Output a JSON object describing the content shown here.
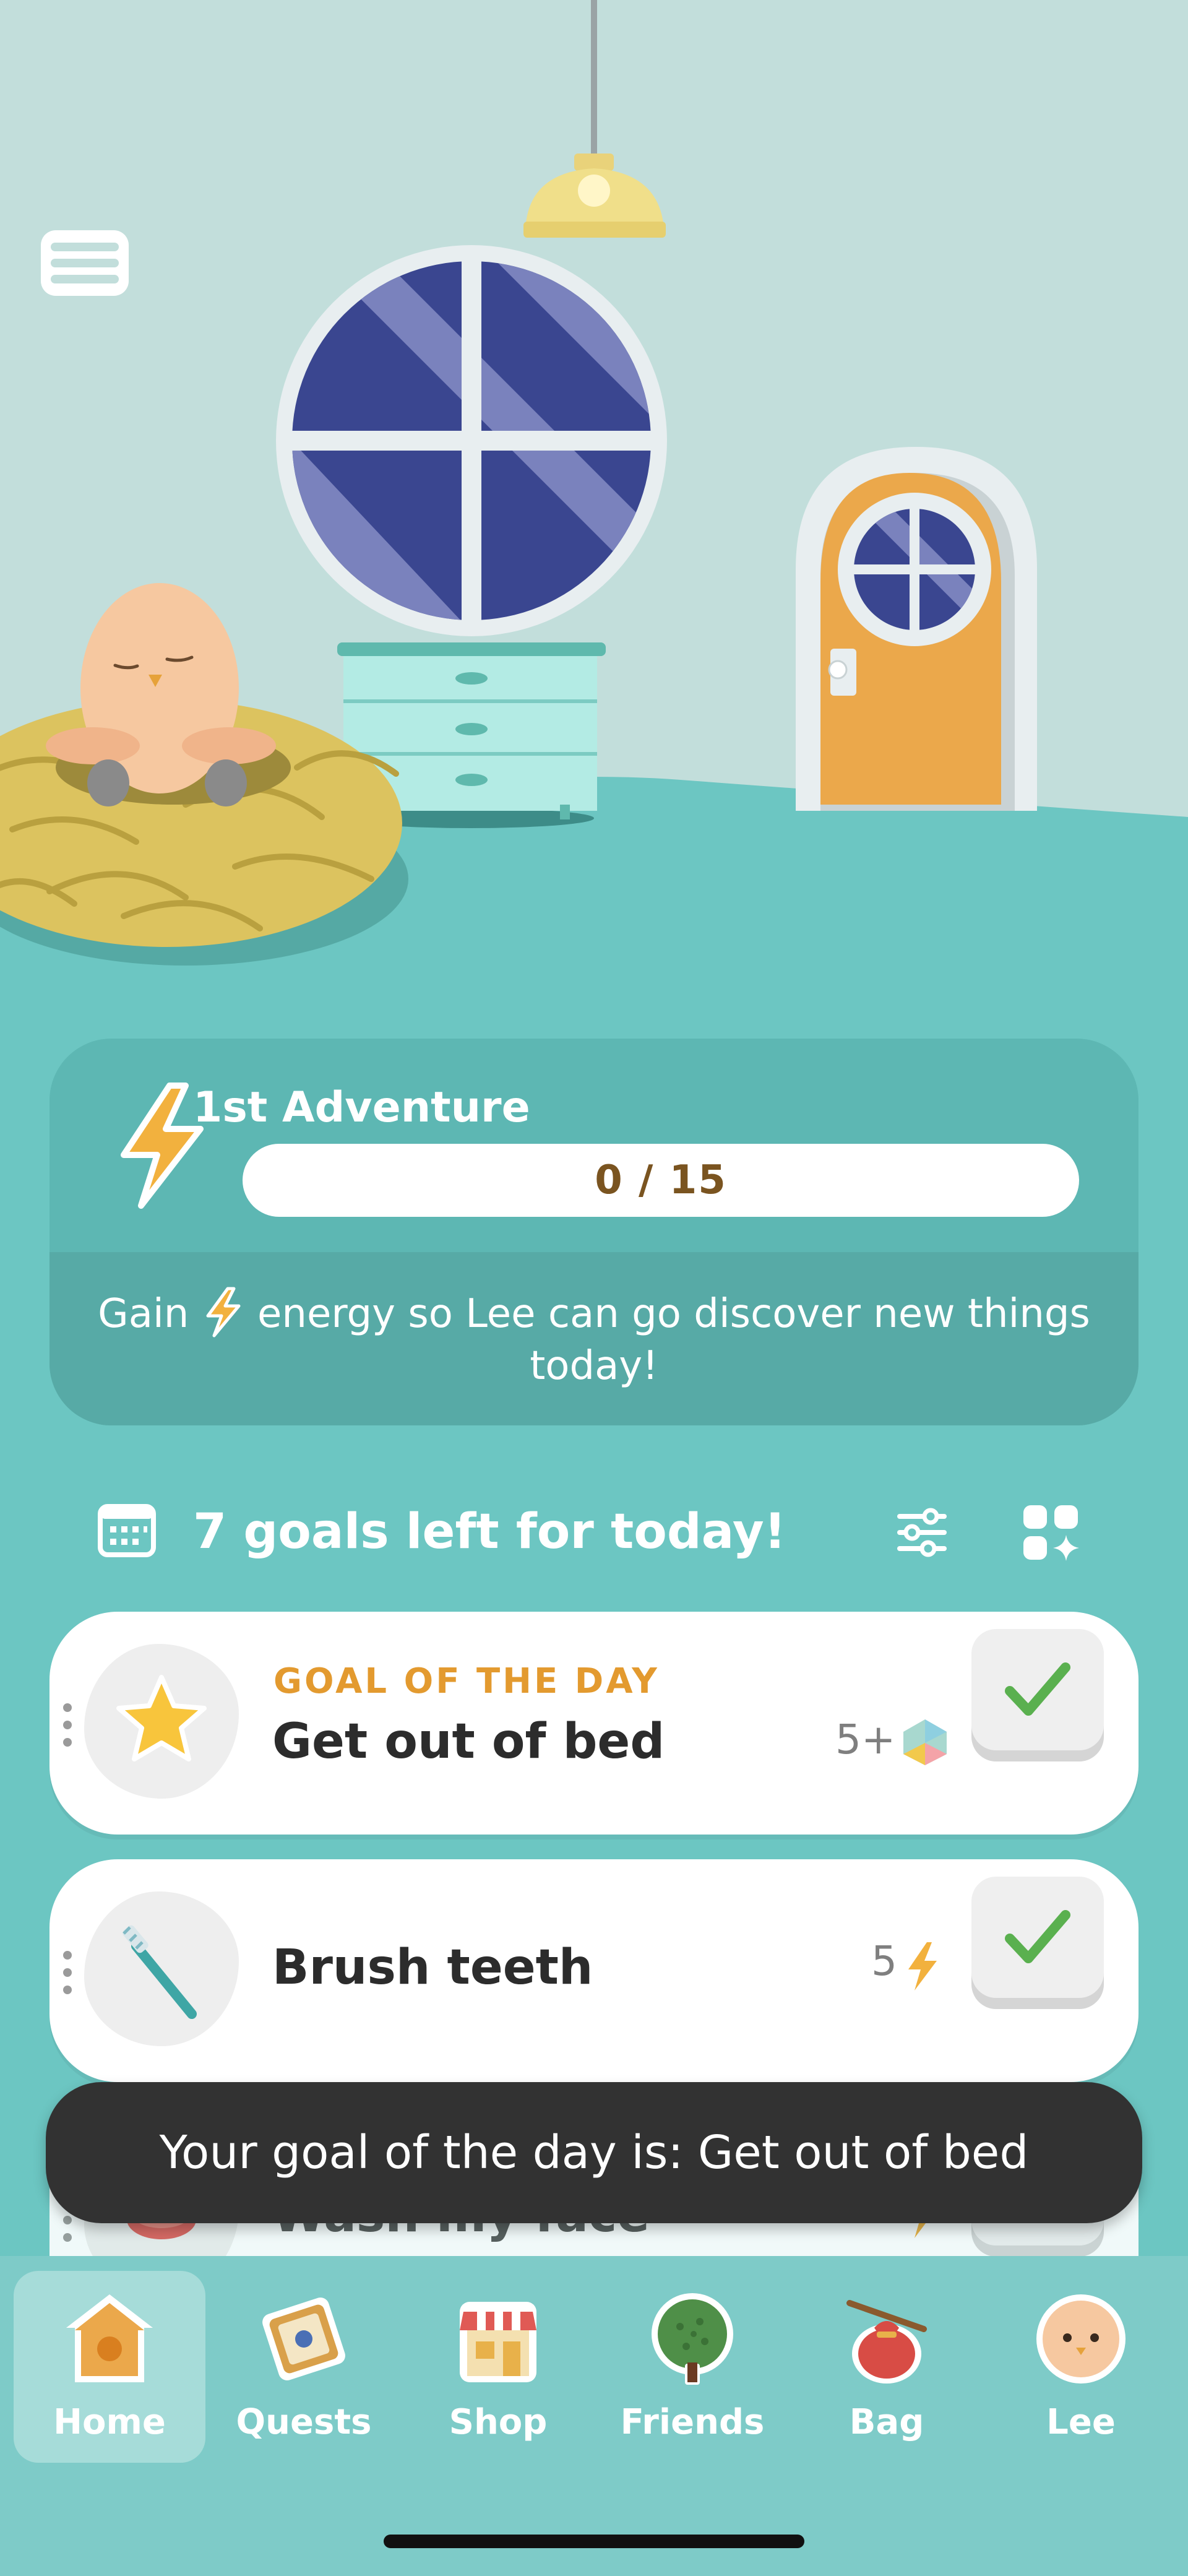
{
  "adventure": {
    "title": "1st Adventure",
    "progress_text": "0 / 15",
    "progress_fraction": 0,
    "description_before": "Gain",
    "description_after": "energy so Lee can go discover new things today!"
  },
  "goals_header": {
    "title": "7 goals left for today!"
  },
  "goals": [
    {
      "eyebrow": "GOAL OF THE DAY",
      "name": "Get out of bed",
      "reward": "5+",
      "icon": "star-icon",
      "reward_icon": "gem-icon"
    },
    {
      "name": "Brush teeth",
      "reward": "5",
      "icon": "toothbrush-icon",
      "reward_icon": "bolt-icon"
    },
    {
      "name": "Wash my face",
      "reward": "5",
      "icon": "soap-icon",
      "reward_icon": "bolt-icon"
    }
  ],
  "toast": {
    "text": "Your goal of the day is: Get out of bed"
  },
  "nav": {
    "items": [
      {
        "label": "Home",
        "icon": "house-icon",
        "active": true
      },
      {
        "label": "Quests",
        "icon": "quest-board-icon"
      },
      {
        "label": "Shop",
        "icon": "shop-icon"
      },
      {
        "label": "Friends",
        "icon": "tree-icon"
      },
      {
        "label": "Bag",
        "icon": "bag-icon"
      },
      {
        "label": "Lee",
        "icon": "avatar-icon"
      }
    ]
  },
  "colors": {
    "background": "#6cc6c2",
    "wall": "#c2dedb",
    "accent_orange": "#e39a2f",
    "check_green": "#5ab04f",
    "toast": "#323232"
  }
}
